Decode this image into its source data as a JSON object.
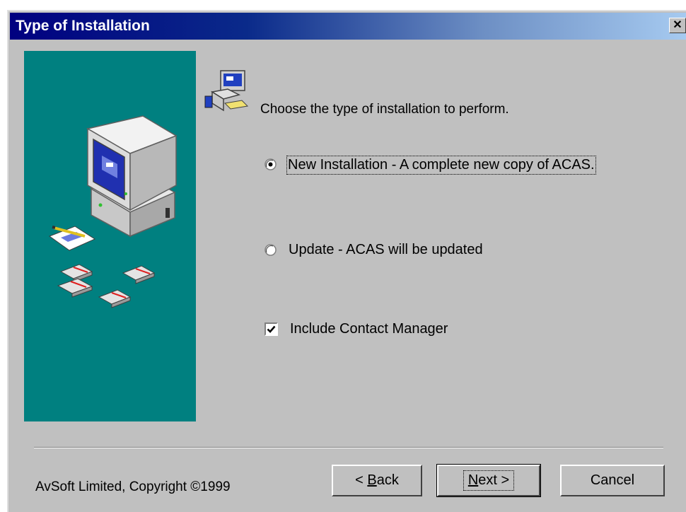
{
  "window": {
    "title": "Type of Installation",
    "close_label": "✕"
  },
  "main": {
    "prompt": "Choose the type of installation to perform.",
    "options": [
      {
        "label": "New Installation - A complete new copy of ACAS.",
        "selected": true
      },
      {
        "label": "Update - ACAS will be updated",
        "selected": false
      }
    ],
    "checkbox": {
      "label": "Include Contact Manager",
      "checked": true
    }
  },
  "footer": {
    "copyright": "AvSoft Limited, Copyright ©1999",
    "back_prefix": "< ",
    "back_accel": "B",
    "back_rest": "ack",
    "next_accel": "N",
    "next_rest": "ext >",
    "cancel_label": "Cancel"
  },
  "colors": {
    "titlebar_start": "#000080",
    "panel": "#008080",
    "face": "#c0c0c0"
  },
  "icons": [
    "computer-illustration",
    "setup-wizard-icon",
    "close-icon"
  ]
}
